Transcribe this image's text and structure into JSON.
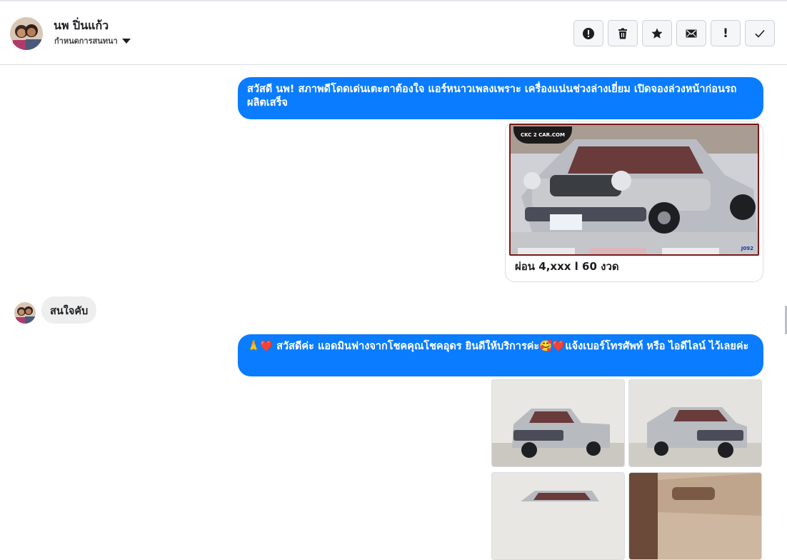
{
  "header": {
    "contact_name": "นพ ปิ่นแก้ว",
    "conversation_settings": "กำหนดการสนทนา",
    "toolbar": [
      {
        "icon": "alert-circle-icon",
        "name": "spam-button"
      },
      {
        "icon": "trash-icon",
        "name": "delete-button"
      },
      {
        "icon": "star-icon",
        "name": "star-button"
      },
      {
        "icon": "envelope-icon",
        "name": "mark-unread-button"
      },
      {
        "icon": "exclamation-icon",
        "name": "follow-up-button",
        "glyph": "!"
      },
      {
        "icon": "check-icon",
        "name": "done-button"
      }
    ]
  },
  "messages": {
    "m1": "สวัสดี นพ! สภาพดีโดดเด่นเตะตาต้องใจ แอร์หนาวเพลงเพราะ เครื่องแน่นช่วงล่างเยี่ยม เปิดจองล่วงหน้าก่อนรถผลิตเสร็จ",
    "card_caption": "ผ่อน 4,xxx l 60 งวด",
    "card_watermark": "CKC 2 CAR.COM",
    "card_tag": "J092",
    "m2": "สนใจคับ",
    "m3": "🙏❤️ สวัสดีค่ะ แอดมินฟางจากโชคคุณโชคอุดร ยินดีให้บริการค่ะ🥰❤️แจ้งเบอร์โทรศัพท์ หรือ ไอดีไลน์  ไว้เลยค่ะ"
  },
  "colors": {
    "outgoing_bubble": "#0a7cff",
    "incoming_bubble": "#eeeeee"
  }
}
